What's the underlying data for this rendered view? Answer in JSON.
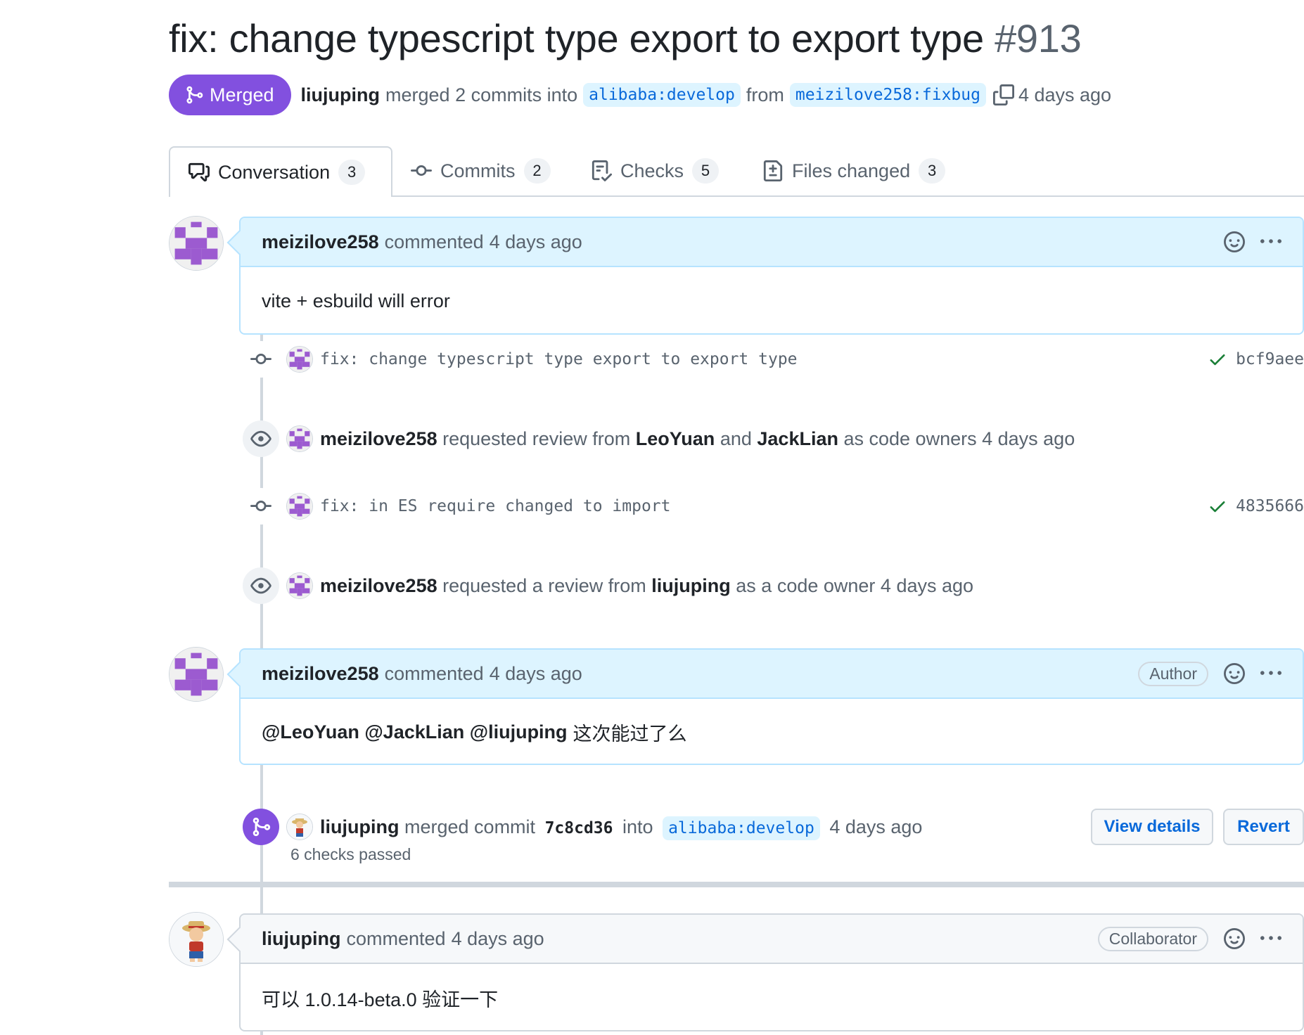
{
  "pr": {
    "title": "fix: change typescript type export to export type",
    "number": "#913",
    "state": "Merged",
    "merged_by": "liujuping",
    "merge_text": "merged 2 commits into",
    "base_branch": "alibaba:develop",
    "from_text": "from",
    "head_branch": "meizilove258:fixbug",
    "time": "4 days ago"
  },
  "tabs": [
    {
      "label": "Conversation",
      "count": "3",
      "icon": "comment-discussion-icon"
    },
    {
      "label": "Commits",
      "count": "2",
      "icon": "git-commit-icon"
    },
    {
      "label": "Checks",
      "count": "5",
      "icon": "checklist-icon"
    },
    {
      "label": "Files changed",
      "count": "3",
      "icon": "file-diff-icon"
    }
  ],
  "timeline": {
    "comment1": {
      "author": "meizilove258",
      "action": "commented",
      "time": "4 days ago",
      "body": "vite + esbuild will error"
    },
    "commit1": {
      "message": "fix: change typescript type export to export type",
      "sha": "bcf9aee"
    },
    "review1": {
      "actor": "meizilove258",
      "t1": "requested review from",
      "r1": "LeoYuan",
      "and": "and",
      "r2": "JackLian",
      "t2": "as code owners",
      "time": "4 days ago"
    },
    "commit2": {
      "message": "fix: in ES require changed to import",
      "sha": "4835666"
    },
    "review2": {
      "actor": "meizilove258",
      "t1": "requested a review from",
      "r1": "liujuping",
      "t2": "as a code owner",
      "time": "4 days ago"
    },
    "comment2": {
      "author": "meizilove258",
      "action": "commented",
      "time": "4 days ago",
      "badge": "Author",
      "mentions": "@LeoYuan @JackLian @liujuping",
      "body": "这次能过了么"
    },
    "merge": {
      "actor": "liujuping",
      "t1": "merged commit",
      "sha": "7c8cd36",
      "t2": "into",
      "branch": "alibaba:develop",
      "time": "4 days ago",
      "checks": "6 checks passed",
      "view_details": "View details",
      "revert": "Revert"
    },
    "comment3": {
      "author": "liujuping",
      "action": "commented",
      "time": "4 days ago",
      "badge": "Collaborator",
      "body": "可以 1.0.14-beta.0 验证一下"
    }
  },
  "colors": {
    "merged": "#8250df",
    "link": "#0969da",
    "comment_head_blue": "#ddf4ff",
    "check": "#1a7f37"
  }
}
